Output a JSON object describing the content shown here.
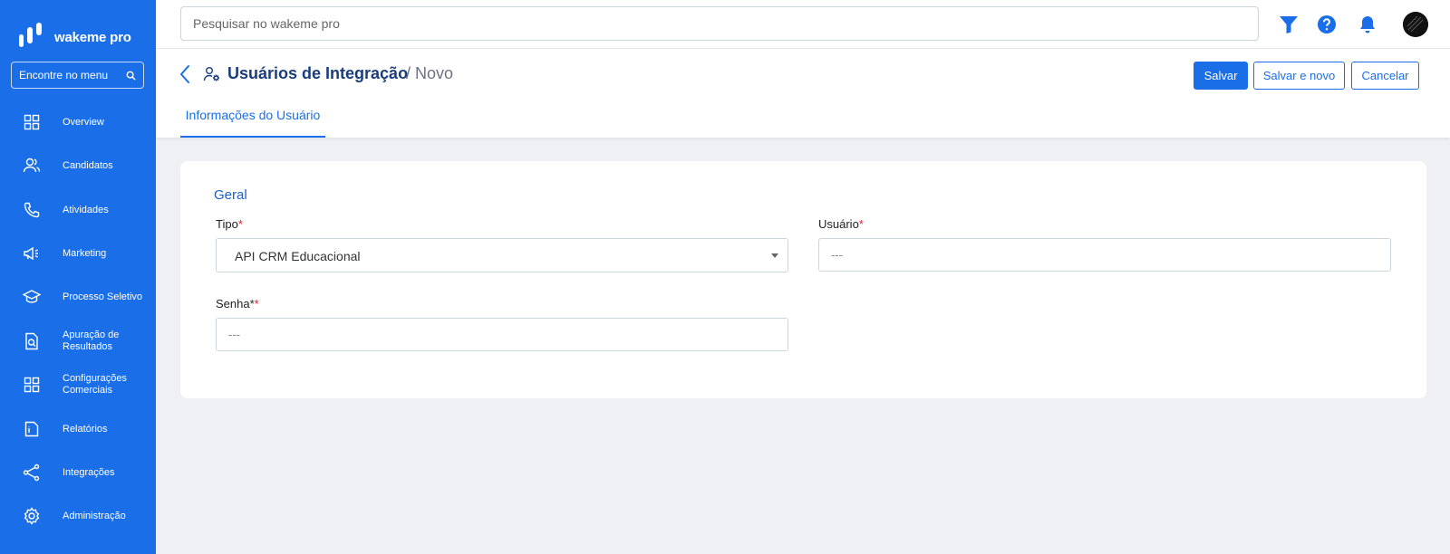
{
  "sidebar": {
    "brand": "wakeme pro",
    "search_placeholder": "Encontre no menu",
    "items": [
      {
        "label": "Overview",
        "icon": "grid-icon"
      },
      {
        "label": "Candidatos",
        "icon": "users-icon"
      },
      {
        "label": "Atividades",
        "icon": "phone-icon"
      },
      {
        "label": "Marketing",
        "icon": "megaphone-icon"
      },
      {
        "label": "Processo Seletivo",
        "icon": "graduation-cap-icon"
      },
      {
        "label": "Apuração de Resultados",
        "icon": "file-search-icon"
      },
      {
        "label": "Configurações Comerciais",
        "icon": "grid-settings-icon"
      },
      {
        "label": "Relatórios",
        "icon": "report-icon"
      },
      {
        "label": "Integrações",
        "icon": "share-icon"
      },
      {
        "label": "Administração",
        "icon": "gear-icon"
      }
    ]
  },
  "topbar": {
    "search_placeholder": "Pesquisar no wakeme pro",
    "icons": [
      "filter-icon",
      "help-icon",
      "bell-icon",
      "avatar"
    ]
  },
  "header": {
    "title": "Usuários de Integração",
    "subtitle": "/ Novo",
    "buttons": {
      "save": "Salvar",
      "save_new": "Salvar e novo",
      "cancel": "Cancelar"
    },
    "tab": "Informações do Usuário"
  },
  "form": {
    "section": "Geral",
    "tipo_label": "Tipo",
    "tipo_value": "API CRM Educacional",
    "usuario_label": "Usuário",
    "usuario_placeholder": "---",
    "senha_label": "Senha*",
    "senha_placeholder": "---",
    "required_mark": "*"
  },
  "colors": {
    "primary": "#1a6fe8",
    "title": "#1a3d7c",
    "required": "#e11d2e",
    "background": "#eef0f3"
  }
}
